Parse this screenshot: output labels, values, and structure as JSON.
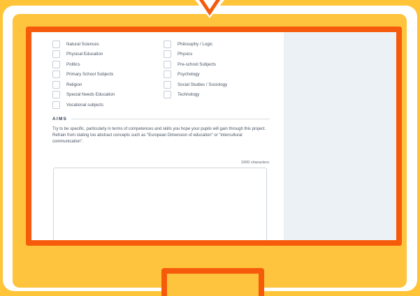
{
  "colors": {
    "background": "#ffc437",
    "frame": "#ffffff",
    "monitor_border": "#f65b0c",
    "side_panel": "#ecf1f6"
  },
  "icons": {
    "pointer": "chevron-down-icon"
  },
  "subjects": {
    "column_1": [
      "Natural Sciences",
      "Physical Education",
      "Politics",
      "Primary School Subjects",
      "Religion",
      "Special Needs Education",
      "Vocational subjects"
    ],
    "column_2": [
      "Philosophy / Logic",
      "Physics",
      "Pre-school Subjects",
      "Psychology",
      "Social Studies / Sociology",
      "Technology"
    ]
  },
  "aims": {
    "title": "AIMS",
    "help_text": "Try to be specific, particularly in terms of competences and skills you hope your pupils will gain through this project. Refrain from stating too abstract concepts such as \"European Dimension of education\" or \"intercultural communication\".",
    "char_limit": "1000 characters",
    "value": ""
  }
}
